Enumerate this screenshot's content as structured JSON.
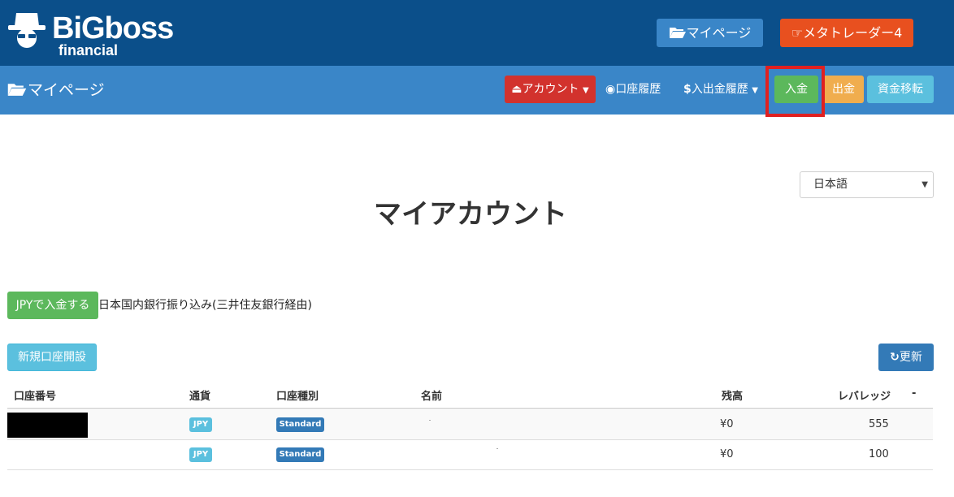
{
  "header": {
    "logo_main": "BiGboss",
    "logo_sub": "financial",
    "mypage_button": "マイページ",
    "mt4_button": "メタトレーダー4",
    "icons": {
      "mypage": "folder-open-icon",
      "mt4": "hand-pointing-icon"
    }
  },
  "nav": {
    "title": "マイページ",
    "account_dropdown": "アカウント",
    "account_history": "口座履歴",
    "inout_history": "入出金履歴",
    "deposit": "入金",
    "withdraw": "出金",
    "transfer": "資金移転"
  },
  "language": {
    "selected": "日本語"
  },
  "main": {
    "title": "マイアカウント",
    "jpy_deposit_button": "JPYで入金する",
    "jpy_deposit_desc": "日本国内銀行振り込み(三井住友銀行経由)",
    "new_account_button": "新規口座開設",
    "refresh_button": "更新"
  },
  "table": {
    "headers": [
      "口座番号",
      "通貨",
      "口座種別",
      "名前",
      "残高",
      "レバレッジ",
      "-"
    ],
    "rows": [
      {
        "account": "",
        "currency": "JPY",
        "type": "Standard",
        "name": "",
        "balance": "¥0",
        "leverage": "555"
      },
      {
        "account": "",
        "currency": "JPY",
        "type": "Standard",
        "name": "",
        "balance": "¥0",
        "leverage": "100"
      }
    ]
  },
  "colors": {
    "header_bg": "#0b4f8a",
    "navbar_bg": "#3a86c8",
    "danger": "#d2322d",
    "success": "#5cb85c",
    "warning": "#f0ad4e",
    "info": "#5bc0de",
    "primary": "#337ab7",
    "mt4": "#e8501f",
    "highlight": "#e02020"
  }
}
